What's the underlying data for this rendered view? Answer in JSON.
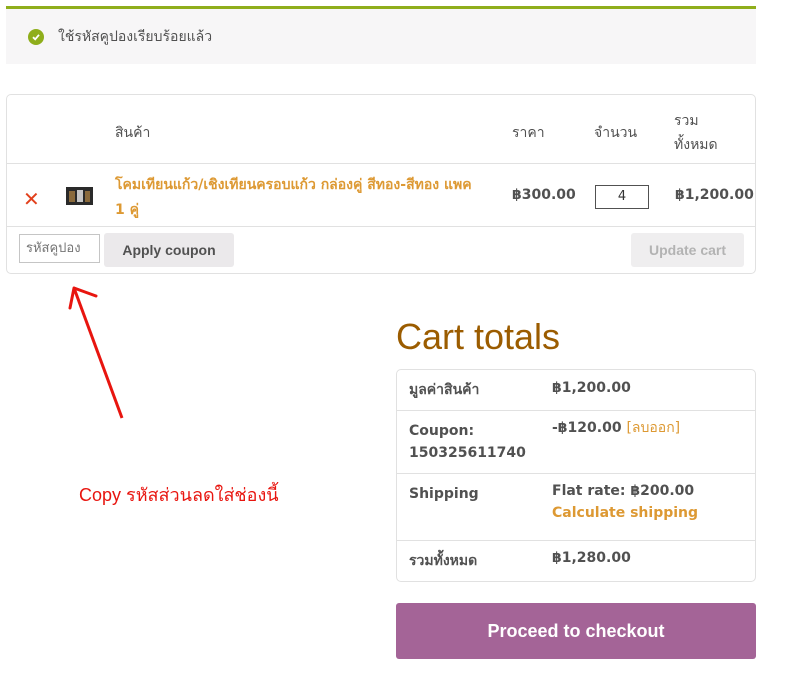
{
  "notice": {
    "message": "ใช้รหัสคูปองเรียบร้อยแล้ว",
    "icon": "check-circle-icon",
    "accent": "#8fae1b"
  },
  "cart": {
    "headers": {
      "product": "สินค้า",
      "price": "ราคา",
      "quantity": "จำนวน",
      "total": "รวม\nทั้งหมด"
    },
    "item": {
      "name": "โคมเทียนแก้ว/เชิงเทียนครอบแก้ว กล่องคู่ สีทอง-สีทอง แพค 1 คู่",
      "price": "฿300.00",
      "quantity": "4",
      "subtotal": "฿1,200.00"
    },
    "coupon_placeholder": "รหัสคูปอง",
    "apply_label": "Apply coupon",
    "update_label": "Update cart"
  },
  "annotation": {
    "text": "Copy รหัสส่วนลดใส่ช่องนี้",
    "color": "#e8150f"
  },
  "totals": {
    "title": "Cart totals",
    "subtotal_label": "มูลค่าสินค้า",
    "subtotal_value": "฿1,200.00",
    "coupon_label_1": "Coupon:",
    "coupon_label_2": "150325611740",
    "coupon_value": "-฿120.00",
    "coupon_remove": "[ลบออก]",
    "shipping_label": "Shipping",
    "shipping_value": "Flat rate: ฿200.00",
    "shipping_calc": "Calculate shipping",
    "total_label": "รวมทั้งหมด",
    "total_value": "฿1,280.00"
  },
  "checkout_label": "Proceed to checkout",
  "colors": {
    "link": "#dd9933",
    "checkout": "#a46497",
    "title": "#9b5c00",
    "remove": "#e2401c"
  }
}
